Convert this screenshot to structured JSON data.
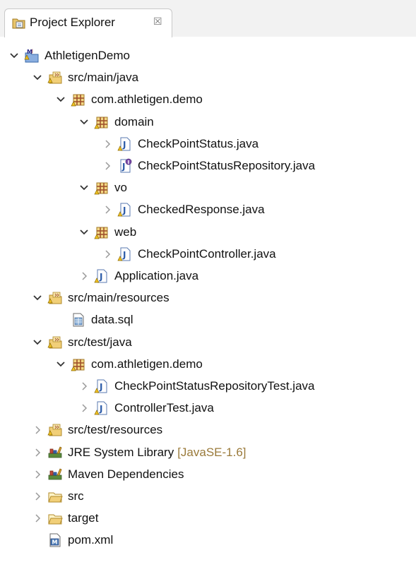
{
  "tab": {
    "title": "Project Explorer",
    "close_glyph": "☒"
  },
  "tree": [
    {
      "label": "AthletigenDemo",
      "expanded": true,
      "icon": "maven-project-icon"
    },
    {
      "label": "src/main/java",
      "expanded": true,
      "icon": "source-folder-icon"
    },
    {
      "label": "com.athletigen.demo",
      "expanded": true,
      "icon": "package-icon"
    },
    {
      "label": "domain",
      "expanded": true,
      "icon": "package-icon"
    },
    {
      "label": "CheckPointStatus.java",
      "expanded": false,
      "icon": "java-file-icon"
    },
    {
      "label": "CheckPointStatusRepository.java",
      "expanded": false,
      "icon": "java-interface-icon"
    },
    {
      "label": "vo",
      "expanded": true,
      "icon": "package-icon"
    },
    {
      "label": "CheckedResponse.java",
      "expanded": false,
      "icon": "java-file-icon"
    },
    {
      "label": "web",
      "expanded": true,
      "icon": "package-icon"
    },
    {
      "label": "CheckPointController.java",
      "expanded": false,
      "icon": "java-file-icon"
    },
    {
      "label": "Application.java",
      "expanded": false,
      "icon": "java-file-icon"
    },
    {
      "label": "src/main/resources",
      "expanded": true,
      "icon": "source-folder-icon"
    },
    {
      "label": "data.sql",
      "expanded": null,
      "icon": "sql-file-icon"
    },
    {
      "label": "src/test/java",
      "expanded": true,
      "icon": "source-folder-icon"
    },
    {
      "label": "com.athletigen.demo",
      "expanded": true,
      "icon": "package-icon"
    },
    {
      "label": "CheckPointStatusRepositoryTest.java",
      "expanded": false,
      "icon": "java-file-icon"
    },
    {
      "label": "ControllerTest.java",
      "expanded": false,
      "icon": "java-file-icon"
    },
    {
      "label": "src/test/resources",
      "expanded": false,
      "icon": "source-folder-icon"
    },
    {
      "label": "JRE System Library",
      "decoration": "[JavaSE-1.6]",
      "expanded": false,
      "icon": "library-icon"
    },
    {
      "label": "Maven Dependencies",
      "expanded": false,
      "icon": "library-icon"
    },
    {
      "label": "src",
      "expanded": false,
      "icon": "folder-icon"
    },
    {
      "label": "target",
      "expanded": false,
      "icon": "folder-icon"
    },
    {
      "label": "pom.xml",
      "expanded": null,
      "icon": "xml-file-icon"
    }
  ]
}
